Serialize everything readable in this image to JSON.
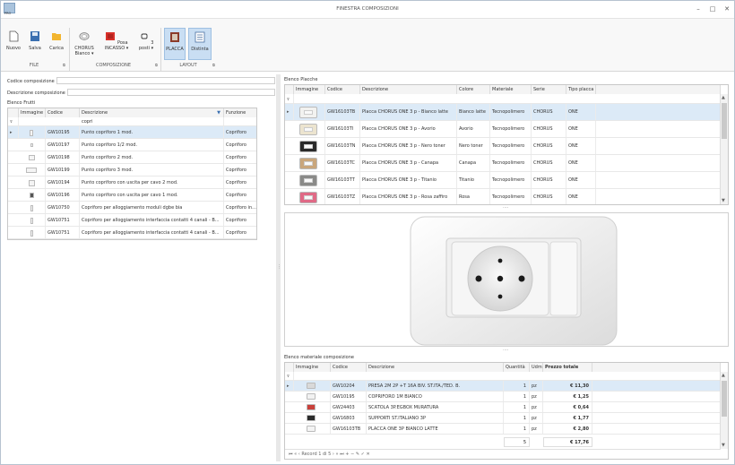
{
  "window": {
    "title": "FINESTRA COMPOSIZIONI",
    "app_sub": "PRO"
  },
  "ribbon": {
    "buttons": [
      {
        "label": "Nuovo"
      },
      {
        "label": "Salva"
      },
      {
        "label": "Carica"
      },
      {
        "label": "CHORUS Bianco"
      },
      {
        "label": "Posa INCASSO"
      },
      {
        "label": "3 posti"
      },
      {
        "label": "PLACCA"
      },
      {
        "label": "Distinta"
      }
    ],
    "groups": [
      "FILE",
      "COMPOSIZIONE",
      "LAYOUT"
    ]
  },
  "left": {
    "codice_label": "Codice composizione",
    "codice_value": "",
    "descrizione_label": "Descrizione composizione",
    "descrizione_value": "",
    "frutti_title": "Elenco Frutti",
    "columns": [
      "Immagine",
      "Codice",
      "Descrizione",
      "Funzione"
    ],
    "filter_value": "copri",
    "rows": [
      {
        "codice": "GW10195",
        "descrizione": "Punto copriforo 1 mod.",
        "funzione": "Copriforo"
      },
      {
        "codice": "GW10197",
        "descrizione": "Punto copriforo 1/2 mod.",
        "funzione": "Copriforo"
      },
      {
        "codice": "GW10198",
        "descrizione": "Punto copriforo 2 mod.",
        "funzione": "Copriforo"
      },
      {
        "codice": "GW10199",
        "descrizione": "Punto copriforo 3 mod.",
        "funzione": "Copriforo"
      },
      {
        "codice": "GW10194",
        "descrizione": "Punto copriforo con uscita per cavo 2 mod.",
        "funzione": "Copriforo"
      },
      {
        "codice": "GW10196",
        "descrizione": "Punto copriforo con uscita per cavo 1 mod.",
        "funzione": "Copriforo"
      },
      {
        "codice": "GW10750",
        "descrizione": "Copriforo per alloggiamento moduli dgbe bia",
        "funzione": "Copriforo in..."
      },
      {
        "codice": "GW10751",
        "descrizione": "Copriforo per alloggiamento interfaccia contatti 4 canali - B...",
        "funzione": "Copriforo"
      },
      {
        "codice": "GW10751",
        "descrizione": "Copriforo per alloggiamento interfaccia contatti 4 canali - B...",
        "funzione": "Copriforo"
      }
    ]
  },
  "placche": {
    "title": "Elenco Placche",
    "columns": [
      "Immagine",
      "Codice",
      "Descrizione",
      "Colore",
      "Materiale",
      "Serie",
      "Tipo placca"
    ],
    "rows": [
      {
        "codice": "GW16103TB",
        "descrizione": "Placca CHORUS ONE 3 p - Bianco latte",
        "colore": "Bianco latte",
        "materiale": "Tecnopolimero",
        "serie": "CHORUS",
        "tipo": "ONE",
        "color": "#f2f2f0"
      },
      {
        "codice": "GW16103TI",
        "descrizione": "Placca CHORUS ONE 3 p - Avorio",
        "colore": "Avorio",
        "materiale": "Tecnopolimero",
        "serie": "CHORUS",
        "tipo": "ONE",
        "color": "#ece4cf"
      },
      {
        "codice": "GW16103TN",
        "descrizione": "Placca CHORUS ONE 3 p - Nero toner",
        "colore": "Nero toner",
        "materiale": "Tecnopolimero",
        "serie": "CHORUS",
        "tipo": "ONE",
        "color": "#2a2a2a"
      },
      {
        "codice": "GW16103TC",
        "descrizione": "Placca CHORUS ONE 3 p - Canapa",
        "colore": "Canapa",
        "materiale": "Tecnopolimero",
        "serie": "CHORUS",
        "tipo": "ONE",
        "color": "#c9a67c"
      },
      {
        "codice": "GW16103TT",
        "descrizione": "Placca CHORUS ONE 3 p - Titanio",
        "colore": "Titanio",
        "materiale": "Tecnopolimero",
        "serie": "CHORUS",
        "tipo": "ONE",
        "color": "#8a8a88"
      },
      {
        "codice": "GW16103TZ",
        "descrizione": "Placca CHORUS ONE 3 p - Rosa zaffiro",
        "colore": "Rosa",
        "materiale": "Tecnopolimero",
        "serie": "CHORUS",
        "tipo": "ONE",
        "color": "#e06a86"
      }
    ]
  },
  "materiale": {
    "title": "Elenco materiale composizione",
    "columns": [
      "Immagine",
      "Codice",
      "Descrizione",
      "Quantità",
      "Udm",
      "Prezzo totale"
    ],
    "rows": [
      {
        "codice": "GW10204",
        "descrizione": "PRESA 2M 2P +T 16A BIV. ST.ITA./TED. B.",
        "qta": "1",
        "udm": "pz",
        "prezzo": "€ 11,30"
      },
      {
        "codice": "GW10195",
        "descrizione": "COPRIFORO 1M BIANCO",
        "qta": "1",
        "udm": "pz",
        "prezzo": "€ 1,25"
      },
      {
        "codice": "GW24403",
        "descrizione": "SCATOLA 3P.EGBOX MURATURA",
        "qta": "1",
        "udm": "pz",
        "prezzo": "€ 0,64"
      },
      {
        "codice": "GW16803",
        "descrizione": "SUPPORTI ST.ITALIANO 3P",
        "qta": "1",
        "udm": "pz",
        "prezzo": "€ 1,77"
      },
      {
        "codice": "GW16103TB",
        "descrizione": "PLACCA ONE 3P BIANCO LATTE",
        "qta": "1",
        "udm": "pz",
        "prezzo": "€ 2,80"
      }
    ],
    "total_qta": "5",
    "total_prezzo": "€ 17,76",
    "nav_record": "Record 1 di 5"
  }
}
